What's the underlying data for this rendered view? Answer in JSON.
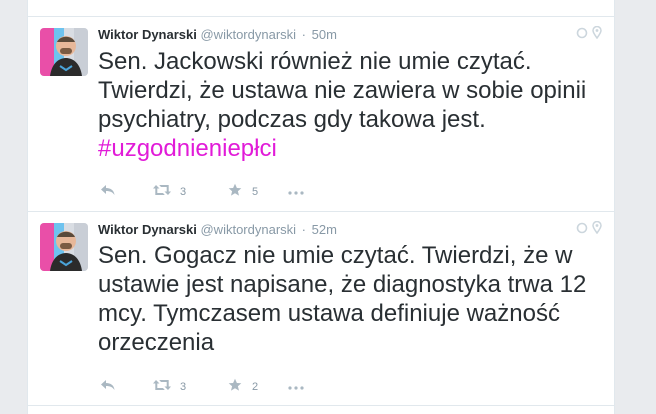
{
  "tweets": [
    {
      "fullname": "Wiktor Dynarski",
      "handle": "@wiktordynarski",
      "separator": "·",
      "time": "50m",
      "text": "Sen. Jackowski również nie umie czytać. Twierdzi, że ustawa nie zawiera w sobie opinii psychiatry, podczas gdy takowa jest.",
      "hashtag": "#uzgodnieniepłci",
      "retweets": "3",
      "favorites": "5"
    },
    {
      "fullname": "Wiktor Dynarski",
      "handle": "@wiktordynarski",
      "separator": "·",
      "time": "52m",
      "text": "Sen. Gogacz nie umie czytać. Twierdzi, że w ustawie jest napisane, że diagnostyka trwa 12 mcy. Tymczasem ustawa definiuje ważność orzeczenia",
      "hashtag": "",
      "retweets": "3",
      "favorites": "2"
    }
  ],
  "icons": {
    "reply": "reply-icon",
    "retweet": "retweet-icon",
    "favorite": "star-icon",
    "more": "more-icon",
    "conversation": "conversation-icon",
    "location": "location-icon"
  },
  "colors": {
    "hashtag": "#e11bd8",
    "text": "#292f33",
    "muted": "#8899a6",
    "divider": "#e1e8ed",
    "background": "#e9ebee"
  }
}
